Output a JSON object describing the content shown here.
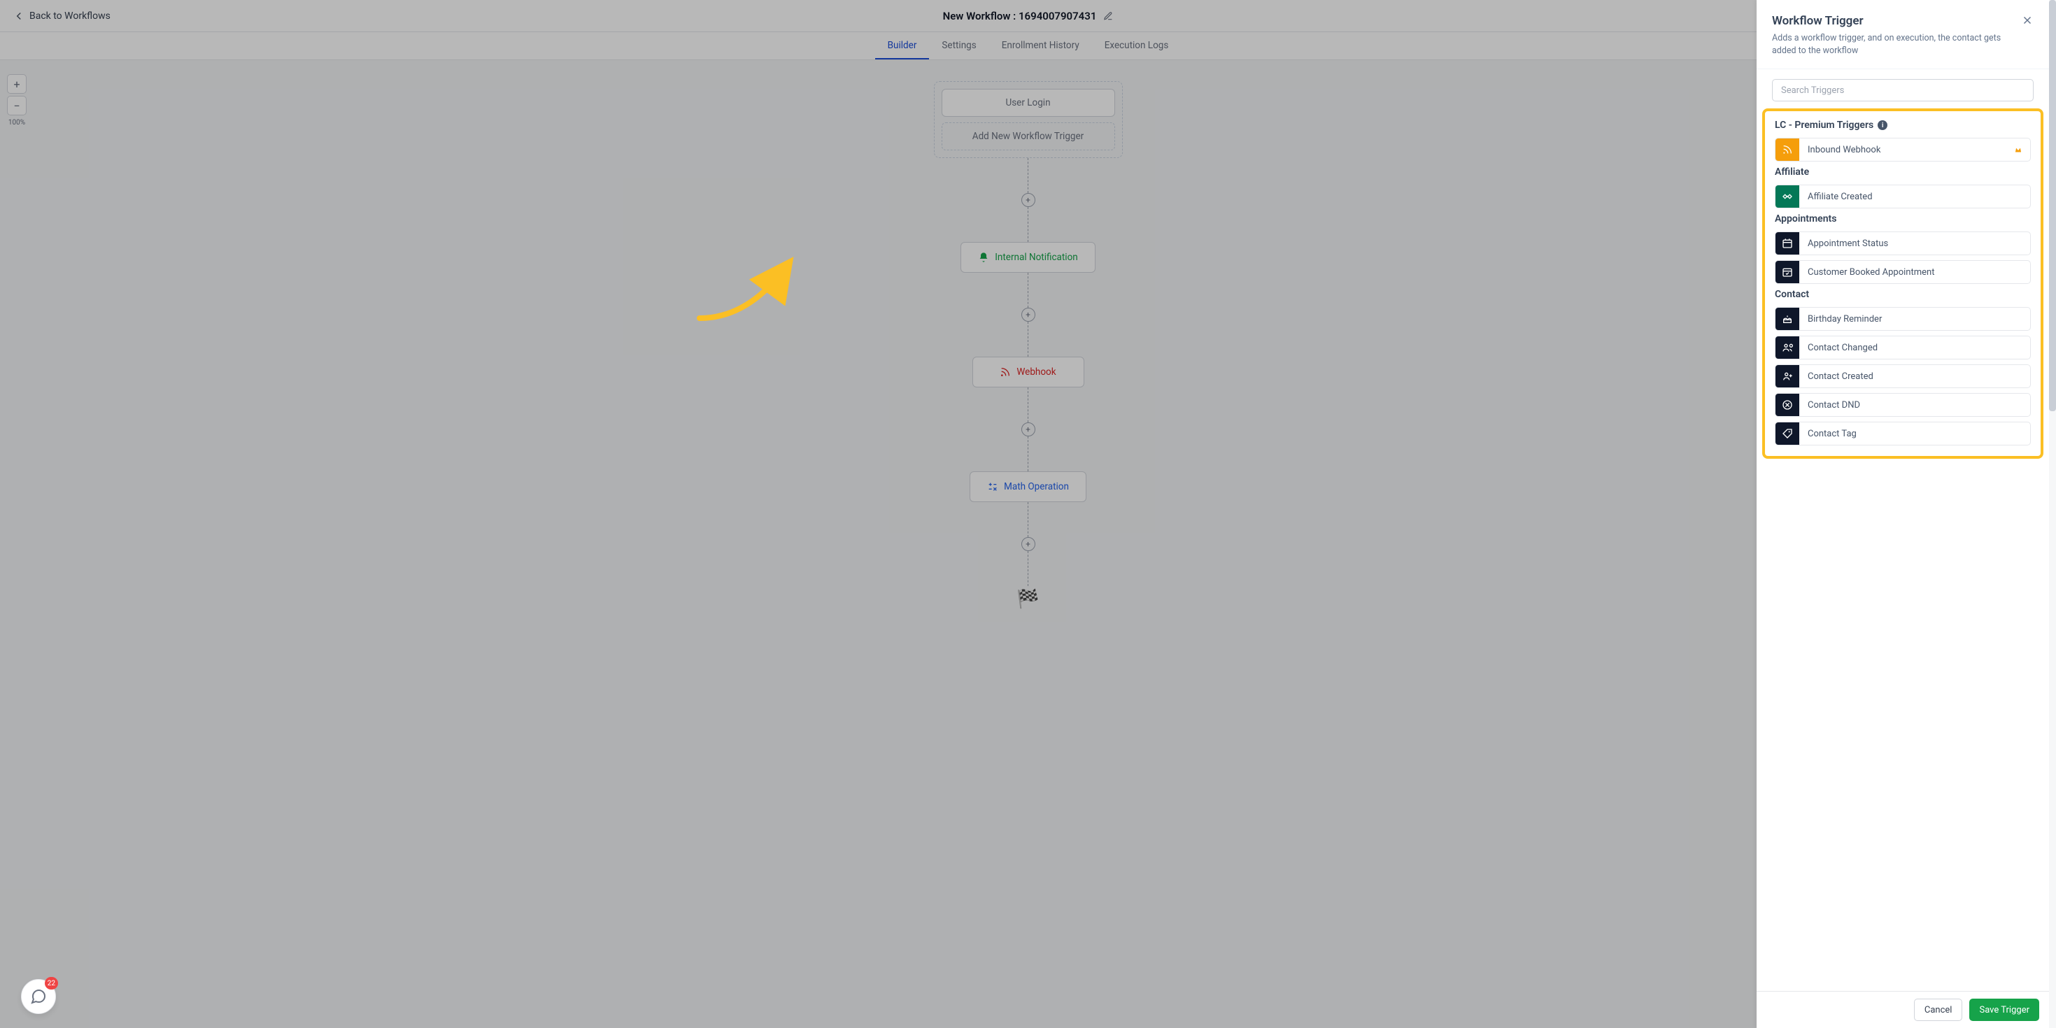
{
  "header": {
    "back_label": "Back to Workflows",
    "title": "New Workflow : 1694007907431"
  },
  "tabs": {
    "builder": "Builder",
    "settings": "Settings",
    "enrollment": "Enrollment History",
    "execution": "Execution Logs"
  },
  "zoom": {
    "plus": "+",
    "minus": "−",
    "level": "100%"
  },
  "canvas": {
    "trigger_slot": "User Login",
    "add_trigger": "Add New Workflow Trigger",
    "nodes": {
      "internal_notification": "Internal Notification",
      "webhook": "Webhook",
      "math_operation": "Math Operation"
    }
  },
  "chat": {
    "badge": "22"
  },
  "panel": {
    "title": "Workflow Trigger",
    "desc": "Adds a workflow trigger, and on execution, the contact gets added to the workflow",
    "search_placeholder": "Search Triggers",
    "footer": {
      "cancel": "Cancel",
      "save": "Save Trigger"
    },
    "groups": [
      {
        "title": "LC - Premium Triggers",
        "info": true,
        "items": [
          {
            "label": "Inbound Webhook",
            "color": "#f59e0b",
            "icon": "rss",
            "premium": true
          }
        ]
      },
      {
        "title": "Affiliate",
        "items": [
          {
            "label": "Affiliate Created",
            "color": "#047857",
            "icon": "handshake"
          }
        ]
      },
      {
        "title": "Appointments",
        "items": [
          {
            "label": "Appointment Status",
            "color": "#0f172a",
            "icon": "calendar"
          },
          {
            "label": "Customer Booked Appointment",
            "color": "#0f172a",
            "icon": "calendar-check"
          }
        ]
      },
      {
        "title": "Contact",
        "items": [
          {
            "label": "Birthday Reminder",
            "color": "#0f172a",
            "icon": "cake"
          },
          {
            "label": "Contact Changed",
            "color": "#0f172a",
            "icon": "users"
          },
          {
            "label": "Contact Created",
            "color": "#0f172a",
            "icon": "user-plus"
          },
          {
            "label": "Contact DND",
            "color": "#0f172a",
            "icon": "dnd"
          },
          {
            "label": "Contact Tag",
            "color": "#0f172a",
            "icon": "tag"
          }
        ]
      }
    ]
  }
}
